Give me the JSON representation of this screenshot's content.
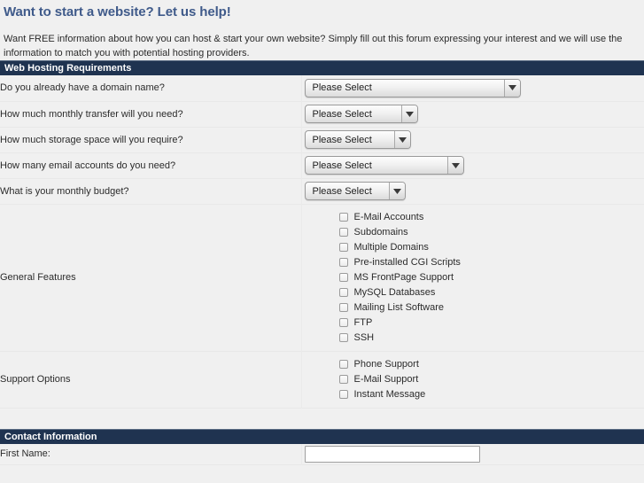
{
  "page": {
    "title": "Want to start a website? Let us help!",
    "intro": "Want FREE information about how you can host & start your own website? Simply fill out this forum expressing your interest and we will use the information to match you with potential hosting providers.",
    "title_color": "#3f5a8a",
    "section_bar_color": "#1f3350",
    "background_color": "#f0f0f0"
  },
  "sections": {
    "hosting": {
      "header": "Web Hosting Requirements"
    },
    "contact": {
      "header": "Contact Information"
    }
  },
  "select_placeholder": "Please Select",
  "questions": [
    {
      "label": "Do you already have a domain name?",
      "value": "Please Select"
    },
    {
      "label": "How much monthly transfer will you need?",
      "value": "Please Select"
    },
    {
      "label": "How much storage space will you require?",
      "value": "Please Select"
    },
    {
      "label": "How many email accounts do you need?",
      "value": "Please Select"
    },
    {
      "label": "What is your monthly budget?",
      "value": "Please Select"
    }
  ],
  "general_features": {
    "label": "General Features",
    "options": [
      {
        "label": "E-Mail Accounts",
        "checked": false
      },
      {
        "label": "Subdomains",
        "checked": false
      },
      {
        "label": "Multiple Domains",
        "checked": false
      },
      {
        "label": "Pre-installed CGI Scripts",
        "checked": false
      },
      {
        "label": "MS FrontPage Support",
        "checked": false
      },
      {
        "label": "MySQL Databases",
        "checked": false
      },
      {
        "label": "Mailing List Software",
        "checked": false
      },
      {
        "label": "FTP",
        "checked": false
      },
      {
        "label": "SSH",
        "checked": false
      }
    ]
  },
  "support_options": {
    "label": "Support Options",
    "options": [
      {
        "label": "Phone Support",
        "checked": false
      },
      {
        "label": "E-Mail Support",
        "checked": false
      },
      {
        "label": "Instant Message",
        "checked": false
      }
    ]
  },
  "contact_fields": [
    {
      "label": "First Name:",
      "value": "",
      "placeholder": ""
    }
  ]
}
